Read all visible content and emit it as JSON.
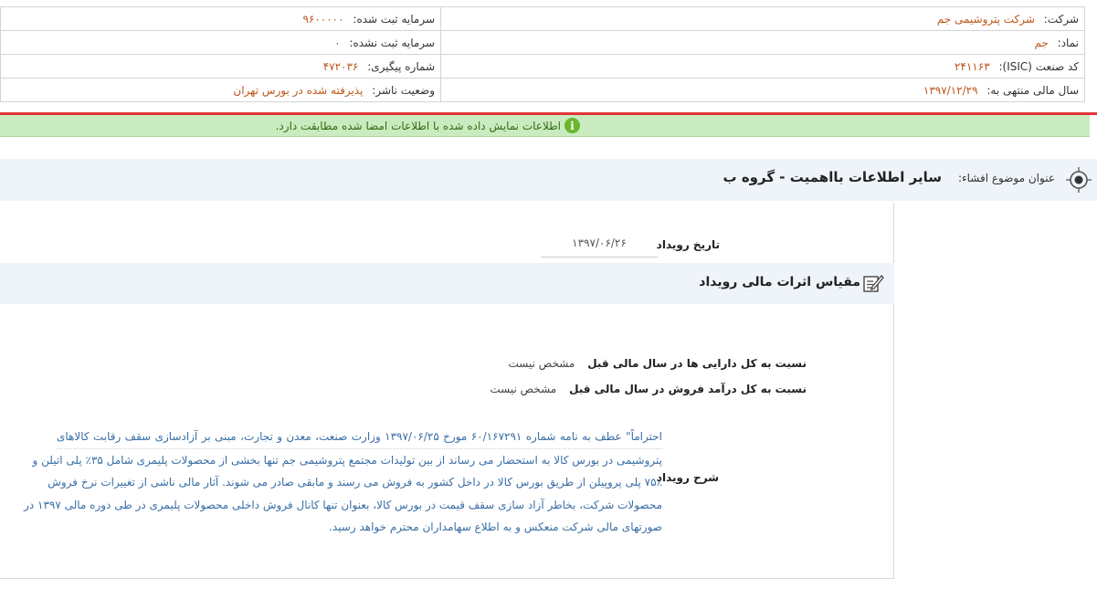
{
  "header": {
    "rows": [
      {
        "left_label": "سرمایه ثبت شده:",
        "left_value": "۹۶۰۰۰۰۰",
        "right_label": "شرکت:",
        "right_value": "شرکت پتروشیمی جم"
      },
      {
        "left_label": "سرمایه ثبت نشده:",
        "left_value": "۰",
        "right_label": "نماد:",
        "right_value": "جم"
      },
      {
        "left_label": "شماره پیگیری:",
        "left_value": "۴۷۲۰۳۶",
        "right_label": "کد صنعت (ISIC):",
        "right_value": "۲۴۱۱۶۳"
      },
      {
        "left_label": "وضعیت ناشر:",
        "left_value": "پذیرفته شده در بورس تهران",
        "right_label": "سال مالی منتهی به:",
        "right_value": "۱۳۹۷/۱۲/۲۹"
      }
    ]
  },
  "notice": {
    "icon": "info-icon",
    "text": "اطلاعات نمایش داده شده با اطلاعات امضا شده مطابقت دارد."
  },
  "subject": {
    "label": "عنوان موضوع افشاء:",
    "title": "سایر اطلاعات بااهمیت - گروه ب"
  },
  "event": {
    "date_label": "تاریخ رویداد",
    "date_value": "۱۳۹۷/۰۶/۲۶"
  },
  "section": {
    "title": "مقیاس اثرات مالی رویداد"
  },
  "ratios": [
    {
      "label": "نسبت به کل دارایی ها در سال مالی قبل",
      "value": "مشخص نیست"
    },
    {
      "label": "نسبت به کل درآمد فروش در سال مالی قبل",
      "value": "مشخص نیست"
    }
  ],
  "description": {
    "label": "شرح رویداد",
    "lines": [
      "احتراماً\" عطف به نامه شماره ۶۰/۱۶۷۲۹۱ مورخ ۱۳۹۷/۰۶/۲۵ وزارت صنعت، معدن و تجارت، مبنی بر آزادسازی سقف رقابت کالاهای",
      "پتروشیمی در بورس کالا به استحضار می رساند از بین تولیدات مجتمع پتروشیمی جم تنها بخشی از محصولات پلیمری شامل ۳۵٪ پلی اتیلن و",
      "۷۵٪ پلی پروپیلن از طریق بورس کالا در داخل کشور به فروش می رسند و مابقی صادر می شوند. آثار مالی ناشی از تغییرات نرخ فروش",
      "محصولات شرکت، بخاطر آزاد سازی سقف قیمت در بورس کالا، بعنوان تنها کانال فروش داخلی محصولات پلیمری در طی دوره مالی ۱۳۹۷ در",
      "صورتهای مالی شرکت منعکس و به اطلاع سهامداران محترم خواهد رسید."
    ]
  },
  "colors": {
    "value_orange": "#c0561a",
    "notice_green": "#c9ebbf",
    "alert_red": "#e03535",
    "link_blue": "#3a6ea5",
    "bar_bg": "#eef4f9"
  }
}
